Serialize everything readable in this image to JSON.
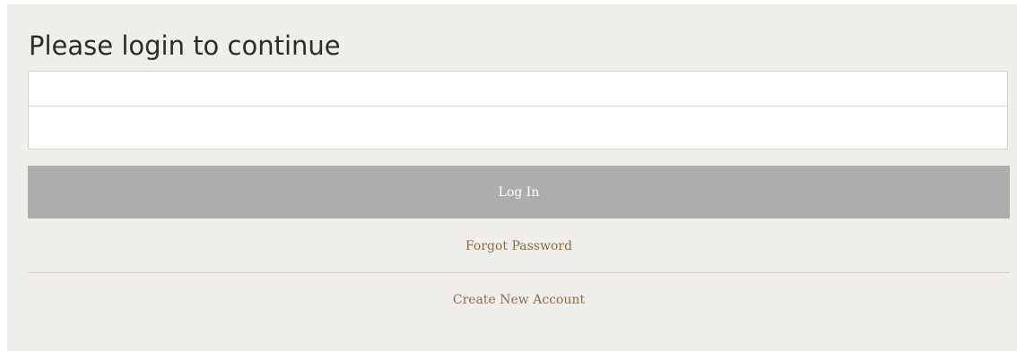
{
  "login": {
    "title": "Please login to continue",
    "username_value": "",
    "password_value": "",
    "login_label": "Log In",
    "forgot_label": "Forgot Password",
    "create_label": "Create New Account"
  },
  "colors": {
    "panel_background": "#f0eeea",
    "button_background": "#adadab",
    "link": "#8f6c48"
  }
}
